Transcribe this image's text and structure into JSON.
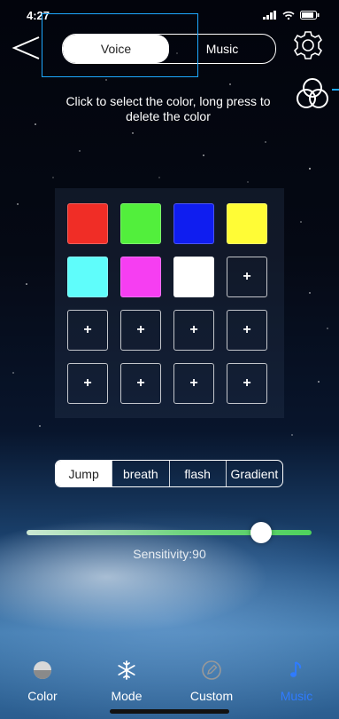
{
  "status": {
    "time": "4:27"
  },
  "header": {
    "tabs": [
      {
        "label": "Voice",
        "active": true
      },
      {
        "label": "Music",
        "active": false
      }
    ],
    "hint": "Click to select the color, long press to delete the color"
  },
  "palette": {
    "colors": [
      "#f02d26",
      "#52ef3c",
      "#0f1df0",
      "#fffc36",
      "#5ffdfb",
      "#f63ef2",
      "#ffffff"
    ],
    "add_symbol": "+"
  },
  "modes": [
    {
      "label": "Jump",
      "active": true
    },
    {
      "label": "breath",
      "active": false
    },
    {
      "label": "flash",
      "active": false
    },
    {
      "label": "Gradient",
      "active": false
    }
  ],
  "sensitivity": {
    "label": "Sensitivity:90",
    "value": 90
  },
  "tabbar": [
    {
      "label": "Color",
      "icon": "color-icon",
      "active": false
    },
    {
      "label": "Mode",
      "icon": "snowflake-icon",
      "active": false
    },
    {
      "label": "Custom",
      "icon": "edit-icon",
      "active": false
    },
    {
      "label": "Music",
      "icon": "music-note-icon",
      "active": true
    }
  ],
  "accent": "#2f7bff"
}
